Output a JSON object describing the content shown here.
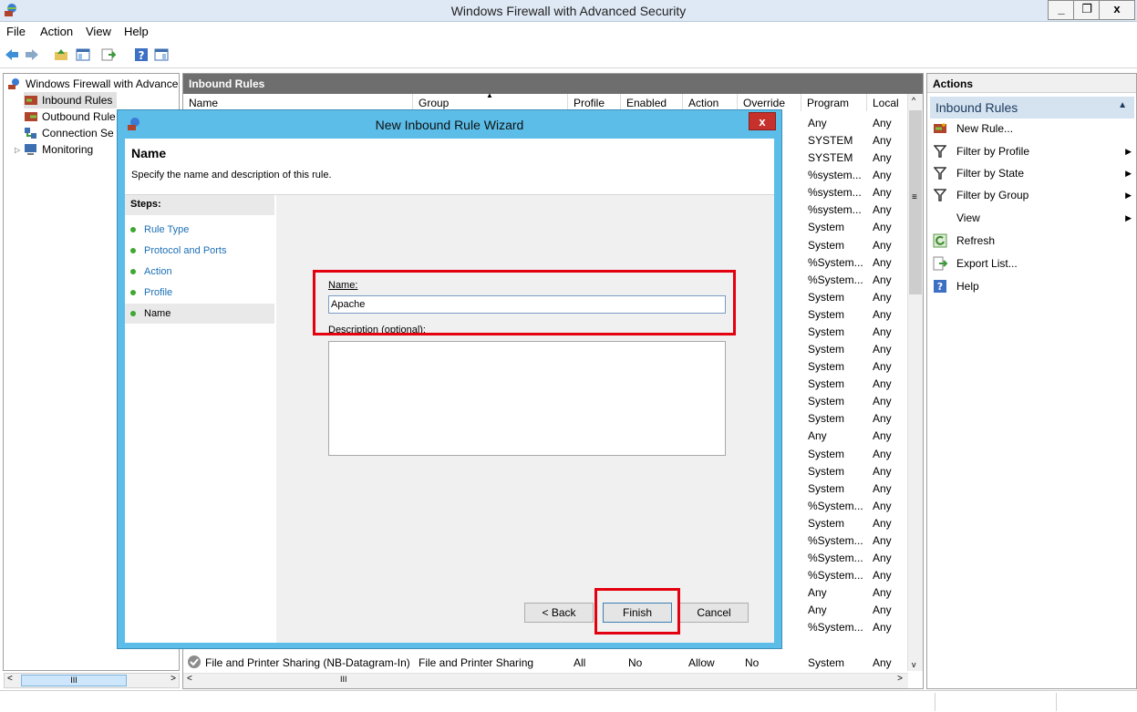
{
  "window": {
    "title": "Windows Firewall with Advanced Security",
    "controls": [
      "_",
      "❐",
      "x"
    ]
  },
  "menu": [
    "File",
    "Action",
    "View",
    "Help"
  ],
  "tree": {
    "items": [
      "Windows Firewall with Advance",
      "Inbound Rules",
      "Outbound Rule",
      "Connection Se",
      "Monitoring"
    ]
  },
  "center": {
    "header": "Inbound Rules",
    "columns": [
      "Name",
      "Group",
      "Profile",
      "Enabled",
      "Action",
      "Override",
      "Program",
      "Local A"
    ],
    "programs": [
      "Any",
      "SYSTEM",
      "SYSTEM",
      "%system...",
      "%system...",
      "%system...",
      "System",
      "System",
      "%System...",
      "%System...",
      "System",
      "System",
      "System",
      "System",
      "System",
      "System",
      "System",
      "System",
      "Any",
      "System",
      "System",
      "System",
      "%System...",
      "System",
      "%System...",
      "%System...",
      "%System...",
      "Any",
      "Any",
      "%System..."
    ],
    "local": "Any",
    "last_row": {
      "name": "File and Printer Sharing (NB-Datagram-In)",
      "group": "File and Printer Sharing",
      "profile": "All",
      "enabled": "No",
      "action": "Allow",
      "override": "No",
      "program": "System",
      "local": "Any"
    },
    "hscroll_label": "III"
  },
  "tree_hscroll_label": "III",
  "actions": {
    "title": "Actions",
    "section": "Inbound Rules",
    "items": [
      {
        "label": "New Rule...",
        "icon": "new-rule-icon",
        "arrow": false
      },
      {
        "label": "Filter by Profile",
        "icon": "filter-icon",
        "arrow": true
      },
      {
        "label": "Filter by State",
        "icon": "filter-icon",
        "arrow": true
      },
      {
        "label": "Filter by Group",
        "icon": "filter-icon",
        "arrow": true
      },
      {
        "label": "View",
        "icon": "",
        "arrow": true
      },
      {
        "label": "Refresh",
        "icon": "refresh-icon",
        "arrow": false
      },
      {
        "label": "Export List...",
        "icon": "export-icon",
        "arrow": false
      },
      {
        "label": "Help",
        "icon": "help-icon",
        "arrow": false
      }
    ]
  },
  "wizard": {
    "title": "New Inbound Rule Wizard",
    "close": "x",
    "heading": "Name",
    "description": "Specify the name and description of this rule.",
    "steps_title": "Steps:",
    "steps": [
      "Rule Type",
      "Protocol and Ports",
      "Action",
      "Profile",
      "Name"
    ],
    "name_label": "Name:",
    "name_value": "Apache",
    "desc_label": "Description (optional):",
    "back_label": "< Back",
    "finish_label": "Finish",
    "cancel_label": "Cancel"
  },
  "colors": {
    "highlight": "#e3000f",
    "wizard_frame": "#5bbde8"
  }
}
